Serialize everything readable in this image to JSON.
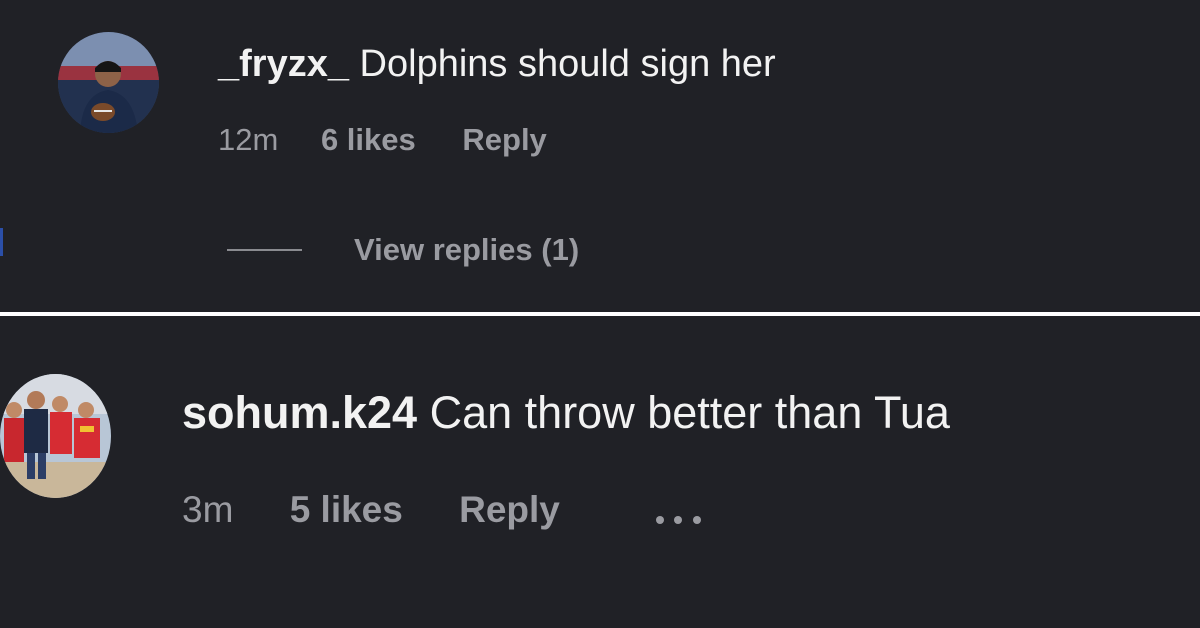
{
  "comments": [
    {
      "username": "_fryzx_",
      "text": "Dolphins should sign her",
      "time": "12m",
      "likes": "6 likes",
      "reply_label": "Reply",
      "view_replies_label": "View replies (1)",
      "avatar_icon": "user-avatar"
    },
    {
      "username": "sohum.k24",
      "text": "Can throw better than Tua",
      "time": "3m",
      "likes": "5 likes",
      "reply_label": "Reply",
      "more_icon": "more-options-icon",
      "avatar_icon": "user-avatar"
    }
  ],
  "colors": {
    "background": "#202126",
    "primary_text": "#f2f2f2",
    "secondary_text": "#9a9ba1",
    "separator": "#ffffff"
  }
}
